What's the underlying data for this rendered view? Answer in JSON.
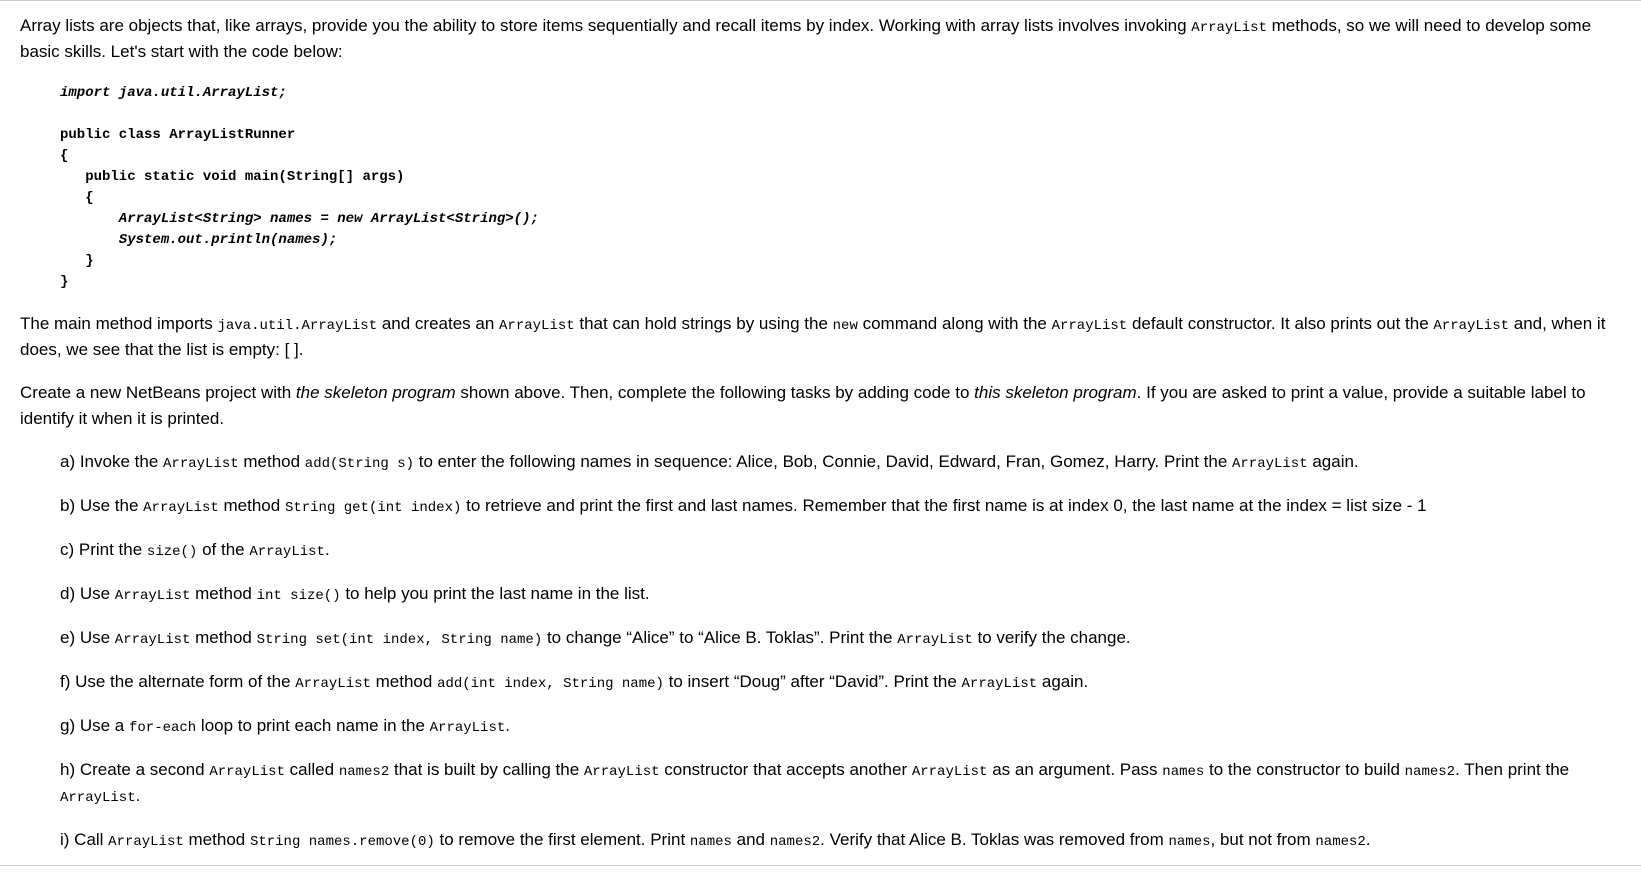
{
  "intro": {
    "p1_a": "Array lists are objects that, like arrays, provide you the ability to store items sequentially and recall items by index. Working with array lists involves invoking ",
    "p1_code": "ArrayList",
    "p1_b": " methods, so we will need to develop some basic skills. Let's start with the code below:"
  },
  "code": {
    "line1": "import java.util.ArrayList;",
    "line2": "",
    "line3": "public class ArrayListRunner",
    "line4": "{",
    "line5": "   public static void main(String[] args)",
    "line6": "   {",
    "line7": "       ArrayList<String> names = new ArrayList<String>();",
    "line8": "       System.out.println(names);",
    "line9": "   }",
    "line10": "}"
  },
  "explain": {
    "p2_0": "The main method imports ",
    "p2_code1": "java.util.ArrayList",
    "p2_1": " and creates an ",
    "p2_code2": "ArrayList",
    "p2_2": " that can hold strings by using the ",
    "p2_code3": "new",
    "p2_3": " command along with the ",
    "p2_code4": "ArrayList",
    "p2_4": " default constructor. It also prints out the ",
    "p2_code5": "ArrayList",
    "p2_5": " and, when it does, we see that the list is empty: [ ]."
  },
  "instruct": {
    "p3_0": "Create a new NetBeans project with ",
    "p3_i1": "the skeleton program",
    "p3_1": " shown above.  Then, complete the following tasks by adding code to ",
    "p3_i2": "this skeleton program",
    "p3_2": ". If you are asked to print a value, provide a suitable label to identify it when it is printed."
  },
  "tasks": {
    "a": {
      "t0": "a) Invoke the ",
      "c1": "ArrayList",
      "t1": " method ",
      "c2": "add(String s)",
      "t2": " to enter the following names in sequence: Alice, Bob, Connie, David, Edward, Fran, Gomez, Harry. Print the ",
      "c3": "ArrayList",
      "t3": " again."
    },
    "b": {
      "t0": "b) Use the ",
      "c1": "ArrayList",
      "t1": " method ",
      "c2": "String get(int index)",
      "t2": " to retrieve and print the first and last names. Remember that the first name is at index 0, the last name at the index = list size - 1"
    },
    "c": {
      "t0": "c) Print the ",
      "c1": "size()",
      "t1": " of the ",
      "c2": "ArrayList",
      "t2": "."
    },
    "d": {
      "t0": "d) Use ",
      "c1": "ArrayList",
      "t1": " method ",
      "c2": "int size()",
      "t2": " to help you print the last name in the list."
    },
    "e": {
      "t0": "e) Use ",
      "c1": "ArrayList",
      "t1": " method ",
      "c2": "String set(int index, String name)",
      "t2": " to change “Alice” to “Alice B. Toklas”. Print the ",
      "c3": "ArrayList",
      "t3": " to verify the change."
    },
    "f": {
      "t0": "f) Use the alternate form of the ",
      "c1": "ArrayList",
      "t1": " method ",
      "c2": "add(int index, String name)",
      "t2": " to insert “Doug” after “David”. Print the ",
      "c3": "ArrayList",
      "t3": " again."
    },
    "g": {
      "t0": "g) Use a ",
      "c1": "for-each",
      "t1": " loop to print each name in the ",
      "c2": "ArrayList",
      "t2": "."
    },
    "h": {
      "t0": "h) Create a second ",
      "c1": "ArrayList",
      "t1": " called ",
      "c2": "names2",
      "t2": " that is built by calling the ",
      "c3": "ArrayList",
      "t3": " constructor that accepts another ",
      "c4": "ArrayList",
      "t4": " as an argument. Pass ",
      "c5": "names",
      "t5": " to the constructor to build ",
      "c6": "names2",
      "t6": ". Then print the ",
      "c7": "ArrayList",
      "t7": "."
    },
    "i": {
      "t0": "i) Call ",
      "c1": "ArrayList",
      "t1": " method ",
      "c2": "String names.remove(0)",
      "t2": " to remove the first element. Print ",
      "c3": "names",
      "t3": " and ",
      "c4": "names2",
      "t4": ". Verify that Alice B. Toklas was removed from ",
      "c5": "names",
      "t5": ", but not from ",
      "c6": "names2",
      "t6": "."
    }
  }
}
